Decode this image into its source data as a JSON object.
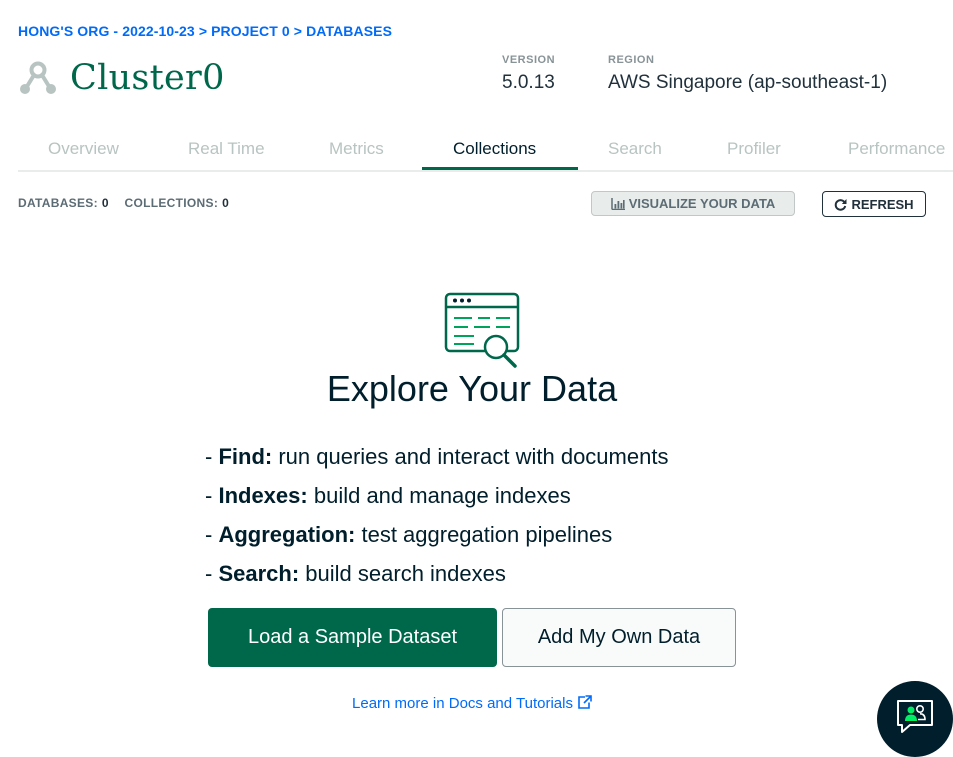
{
  "breadcrumb": {
    "org": "HONG'S ORG - 2022-10-23",
    "separator": ">",
    "project": "PROJECT 0",
    "section": "DATABASES"
  },
  "cluster": {
    "name": "Cluster0",
    "icon": "cluster-icon"
  },
  "meta": {
    "version_label": "VERSION",
    "version_value": "5.0.13",
    "region_label": "REGION",
    "region_value": "AWS Singapore (ap-southeast-1)"
  },
  "tabs": [
    {
      "label": "Overview",
      "active": false
    },
    {
      "label": "Real Time",
      "active": false
    },
    {
      "label": "Metrics",
      "active": false
    },
    {
      "label": "Collections",
      "active": true
    },
    {
      "label": "Search",
      "active": false
    },
    {
      "label": "Profiler",
      "active": false
    },
    {
      "label": "Performance",
      "active": false
    }
  ],
  "stats": {
    "databases_label": "DATABASES:",
    "databases_count": "0",
    "collections_label": "COLLECTIONS:",
    "collections_count": "0"
  },
  "toolbar": {
    "visualize_label": "VISUALIZE YOUR DATA",
    "visualize_icon": "bar-chart-icon",
    "refresh_label": "REFRESH",
    "refresh_icon": "refresh-icon"
  },
  "empty_state": {
    "icon": "browser-search-icon",
    "title": "Explore Your Data",
    "features": [
      {
        "name": "Find:",
        "desc": "run queries and interact with documents"
      },
      {
        "name": "Indexes:",
        "desc": "build and manage indexes"
      },
      {
        "name": "Aggregation:",
        "desc": "test aggregation pipelines"
      },
      {
        "name": "Search:",
        "desc": "build search indexes"
      }
    ],
    "bullet": "-",
    "load_sample_label": "Load a Sample Dataset",
    "add_own_label": "Add My Own Data",
    "learn_more_label": "Learn more in Docs and Tutorials",
    "learn_more_icon": "external-link-icon"
  },
  "chat": {
    "icon": "chat-support-icon"
  },
  "colors": {
    "brand_green": "#00684a",
    "link_blue": "#016bf8",
    "dark_navy": "#001e2b",
    "icon_green": "#00a35c"
  }
}
